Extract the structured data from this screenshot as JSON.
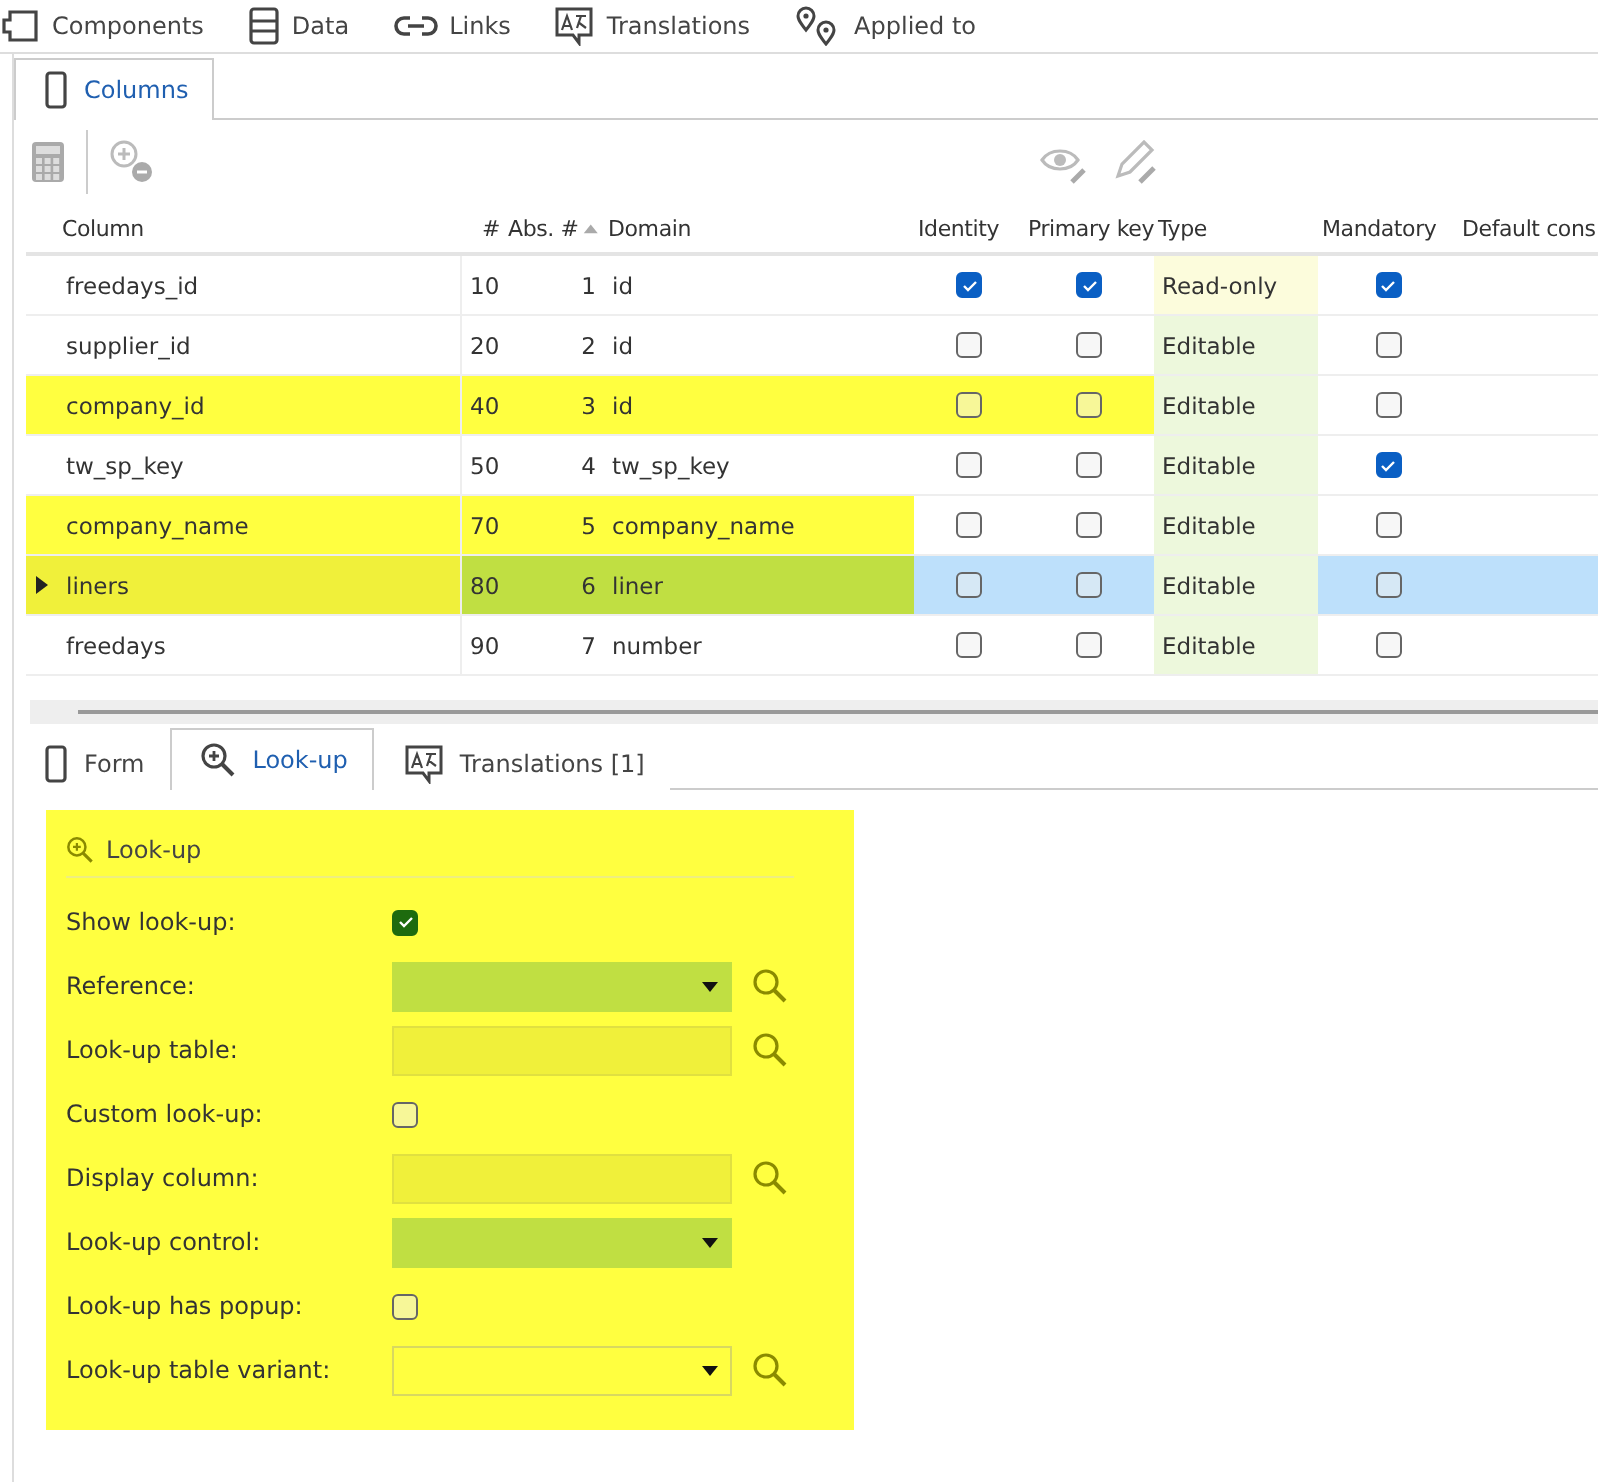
{
  "top_tabs": [
    {
      "label": "Components"
    },
    {
      "label": "Data"
    },
    {
      "label": "Links"
    },
    {
      "label": "Translations"
    },
    {
      "label": "Applied to"
    }
  ],
  "main_tab": {
    "label": "Columns",
    "selected": true
  },
  "table": {
    "columns": [
      "Column",
      "#",
      "Abs. #",
      "Domain",
      "Identity",
      "Primary key",
      "Type",
      "Mandatory",
      "Default cons"
    ],
    "rows": [
      {
        "column": "freedays_id",
        "number": "10",
        "abs": "1",
        "domain": "id",
        "identity": true,
        "primary_key": true,
        "type": "Read-only",
        "editable": false,
        "mandatory": true,
        "highlighted": false,
        "selected": false
      },
      {
        "column": "supplier_id",
        "number": "20",
        "abs": "2",
        "domain": "id",
        "identity": false,
        "primary_key": false,
        "type": "Editable",
        "editable": true,
        "mandatory": false,
        "highlighted": false,
        "selected": false
      },
      {
        "column": "company_id",
        "number": "40",
        "abs": "3",
        "domain": "id",
        "identity": false,
        "primary_key": false,
        "type": "Editable",
        "editable": true,
        "mandatory": false,
        "highlighted": true,
        "highlight_extended": true,
        "selected": false
      },
      {
        "column": "tw_sp_key",
        "number": "50",
        "abs": "4",
        "domain": "tw_sp_key",
        "identity": false,
        "primary_key": false,
        "type": "Editable",
        "editable": true,
        "mandatory": true,
        "highlighted": false,
        "selected": false
      },
      {
        "column": "company_name",
        "number": "70",
        "abs": "5",
        "domain": "company_name",
        "identity": false,
        "primary_key": false,
        "type": "Editable",
        "editable": true,
        "mandatory": false,
        "highlighted": true,
        "highlight_extended": false,
        "selected": false
      },
      {
        "column": "liners",
        "number": "80",
        "abs": "6",
        "domain": "liner",
        "identity": false,
        "primary_key": false,
        "type": "Editable",
        "editable": true,
        "mandatory": false,
        "highlighted": true,
        "highlight_extended": false,
        "selected": true
      },
      {
        "column": "freedays",
        "number": "90",
        "abs": "7",
        "domain": "number",
        "identity": false,
        "primary_key": false,
        "type": "Editable",
        "editable": true,
        "mandatory": false,
        "highlighted": false,
        "selected": false
      }
    ]
  },
  "bottom_tabs": [
    {
      "label": "Form",
      "selected": false
    },
    {
      "label": "Look-up",
      "selected": true
    },
    {
      "label": "Translations [1]",
      "selected": false
    }
  ],
  "lookup_panel": {
    "title": "Look-up",
    "fields": [
      {
        "label": "Show look-up:",
        "kind": "checkbox",
        "checked": true
      },
      {
        "label": "Reference:",
        "kind": "dropdown",
        "highlighted": true,
        "has_search": true
      },
      {
        "label": "Look-up table:",
        "kind": "text",
        "has_search": true
      },
      {
        "label": "Custom look-up:",
        "kind": "checkbox",
        "checked": false
      },
      {
        "label": "Display column:",
        "kind": "text",
        "has_search": true
      },
      {
        "label": "Look-up control:",
        "kind": "dropdown",
        "highlighted": true,
        "has_search": false
      },
      {
        "label": "Look-up has popup:",
        "kind": "checkbox",
        "checked": false
      },
      {
        "label": "Look-up table variant:",
        "kind": "dropdown",
        "highlighted": false,
        "has_search": true
      }
    ]
  }
}
